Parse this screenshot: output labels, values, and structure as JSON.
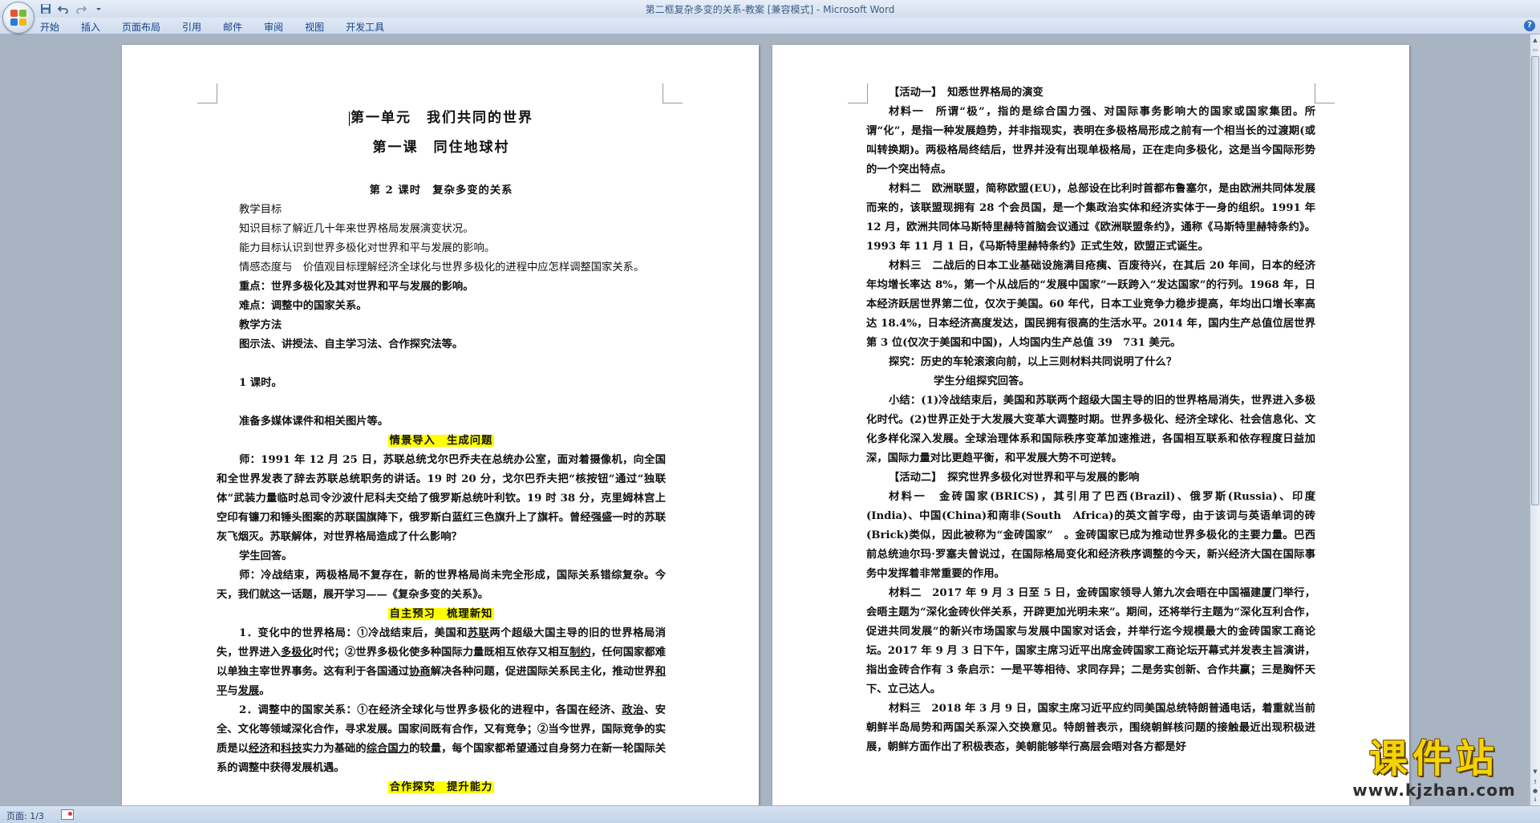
{
  "window": {
    "title": "第二框复杂多变的关系-教案 [兼容模式] - Microsoft Word"
  },
  "quick_access": [
    {
      "name": "save-icon",
      "glyph": "💾"
    },
    {
      "name": "undo-icon",
      "glyph": "↶"
    },
    {
      "name": "redo-icon",
      "glyph": "↷"
    },
    {
      "name": "customize-icon",
      "glyph": "▾"
    }
  ],
  "ribbon": {
    "tabs": [
      "开始",
      "插入",
      "页面布局",
      "引用",
      "邮件",
      "审阅",
      "视图",
      "开发工具"
    ]
  },
  "page1": {
    "title1": "第一单元　我们共同的世界",
    "title2": "第一课　同住地球村",
    "title3": "第 2 课时　复杂多变的关系",
    "goals_heading": "教学目标",
    "goal_knowledge": "知识目标了解近几十年来世界格局发展演变状况。",
    "goal_ability": "能力目标认识到世界多极化对世界和平与发展的影响。",
    "goal_emotion": "情感态度与　价值观目标理解经济全球化与世界多极化的进程中应怎样调整国家关系。",
    "key_point": "重点：世界多极化及其对世界和平与发展的影响。",
    "difficulty": "难点：调整中的国家关系。",
    "method_heading": "教学方法",
    "methods": "图示法、讲授法、自主学习法、合作探究法等。",
    "lesson_time": "1 课时。",
    "prep": "准备多媒体课件和相关图片等。",
    "section1": "情景导入　生成问题",
    "teacher1": "师：1991 年 12 月 25 日，苏联总统戈尔巴乔夫在总统办公室，面对着摄像机，向全国和全世界发表了辞去苏联总统职务的讲话。19 时 20 分，戈尔巴乔夫把“核按钮”通过“独联体”武装力量临时总司令沙波什尼科夫交给了俄罗斯总统叶利钦。19 时 38 分，克里姆林宫上空印有镰刀和锤头图案的苏联国旗降下，俄罗斯白蓝红三色旗升上了旗杆。曾经强盛一时的苏联灰飞烟灭。苏联解体，对世界格局造成了什么影响？",
    "student1": "学生回答。",
    "teacher2": "师：冷战结束，两极格局不复存在，新的世界格局尚未完全形成，国际关系错综复杂。今天，我们就这一话题，展开学习——《复杂多变的关系》。",
    "section2": "自主预习　梳理新知",
    "item1": {
      "a": "1．变化中的世界格局：①冷战结束后，美国和",
      "b": "苏联",
      "c": "两个超级大国主导的旧的世界格局消失，世界进入",
      "d": "多极化",
      "e": "时代；②世界多极化使多种国际力量既相互依存又相互",
      "f": "制约",
      "g": "，任何国家都难以单独主宰世界事务。这有利于各国通过",
      "h": "协商",
      "i": "解决各种问题，促进国际关系民主化，推动世界",
      "j": "和平",
      "k": "与",
      "l": "发展",
      "m": "。"
    },
    "item2": {
      "a": "2．调整中的国家关系：①在经济全球化与世界多极化的进程中，各国在经济、",
      "b": "政治",
      "c": "、安全、文化等领域深化合作，寻求发展。国家间既有合作，又有竞争；②当今世界，国际竞争的实质是以",
      "d": "经济",
      "e": "和",
      "f": "科技",
      "g": "实力为基础的",
      "h": "综合国力",
      "i": "的较量，每个国家都希望通过自身努力在新一轮国际关系的调整中获得发展机遇。"
    },
    "section3": "合作探究　提升能力"
  },
  "page2": {
    "activity1": "【活动一】　知悉世界格局的演变",
    "m1": "材料一　所谓“极”，指的是综合国力强、对国际事务影响大的国家或国家集团。所谓“化”，是指一种发展趋势，并非指现实，表明在多极格局形成之前有一个相当长的过渡期(或叫转换期)。两极格局终结后，世界并没有出现单极格局，正在走向多极化，这是当今国际形势的一个突出特点。",
    "m2": "材料二　欧洲联盟，简称欧盟(EU)，总部设在比利时首都布鲁塞尔，是由欧洲共同体发展而来的，该联盟现拥有 28 个会员国，是一个集政治实体和经济实体于一身的组织。1991 年 12 月，欧洲共同体马斯特里赫特首脑会议通过《欧洲联盟条约》，通称《马斯特里赫特条约》。1993 年 11 月 1 日，《马斯特里赫特条约》正式生效，欧盟正式诞生。",
    "m3": "材料三　二战后的日本工业基础设施满目疮痍、百废待兴，在其后 20 年间，日本的经济年均增长率达 8%，第一个从战后的“发展中国家”一跃跨入“发达国家”的行列。1968 年，日本经济跃居世界第二位，仅次于美国。60 年代，日本工业竞争力稳步提高，年均出口增长率高达 18.4%，日本经济高度发达，国民拥有很高的生活水平。2014 年，国内生产总值位居世界第 3 位(仅次于美国和中国)，人均国内生产总值 39　731 美元。",
    "explore1": "探究：历史的车轮滚滚向前，以上三则材料共同说明了什么？",
    "group1": "学生分组探究回答。",
    "summary1": "小结：(1)冷战结束后，美国和苏联两个超级大国主导的旧的世界格局消失，世界进入多极化时代。(2)世界正处于大发展大变革大调整时期。世界多极化、经济全球化、社会信息化、文化多样化深入发展。全球治理体系和国际秩序变革加速推进，各国相互联系和依存程度日益加深，国际力量对比更趋平衡，和平发展大势不可逆转。",
    "activity2": "【活动二】　探究世界多极化对世界和平与发展的影响",
    "n1": "材料一　金砖国家(BRICS)，其引用了巴西(Brazil)、俄罗斯(Russia)、印度(India)、中国(China)和南非(South　Africa)的英文首字母，由于该词与英语单词的砖(Brick)类似，因此被称为“金砖国家”　。金砖国家已成为推动世界多极化的主要力量。巴西前总统迪尔玛·罗塞夫曾说过，在国际格局变化和经济秩序调整的今天，新兴经济大国在国际事务中发挥着非常重要的作用。",
    "n2": "材料二　2017 年 9 月 3 日至 5 日，金砖国家领导人第九次会晤在中国福建厦门举行，会晤主题为“深化金砖伙伴关系，开辟更加光明未来”。期间，还将举行主题为“深化互利合作，促进共同发展”的新兴市场国家与发展中国家对话会，并举行迄今规模最大的金砖国家工商论坛。2017 年 9 月 3 日下午，国家主席习近平出席金砖国家工商论坛开幕式并发表主旨演讲，指出金砖合作有 3 条启示：一是平等相待、求同存异；二是务实创新、合作共赢；三是胸怀天下、立己达人。",
    "n3": "材料三　2018 年 3 月 9 日，国家主席习近平应约同美国总统特朗普通电话，着重就当前朝鲜半岛局势和两国关系深入交换意见。特朗普表示，围绕朝鲜核问题的接触最近出现积极进展，朝鲜方面作出了积极表态，美朝能够举行高层会晤对各方都是好"
  },
  "status": {
    "page": "页面: 1/3"
  },
  "watermark": {
    "title": "课件站",
    "url": "www.kjzhan.com"
  },
  "colors": {
    "highlight": "#ffff00",
    "ribbon_text": "#15428b",
    "title_text": "#3e5c8a"
  }
}
